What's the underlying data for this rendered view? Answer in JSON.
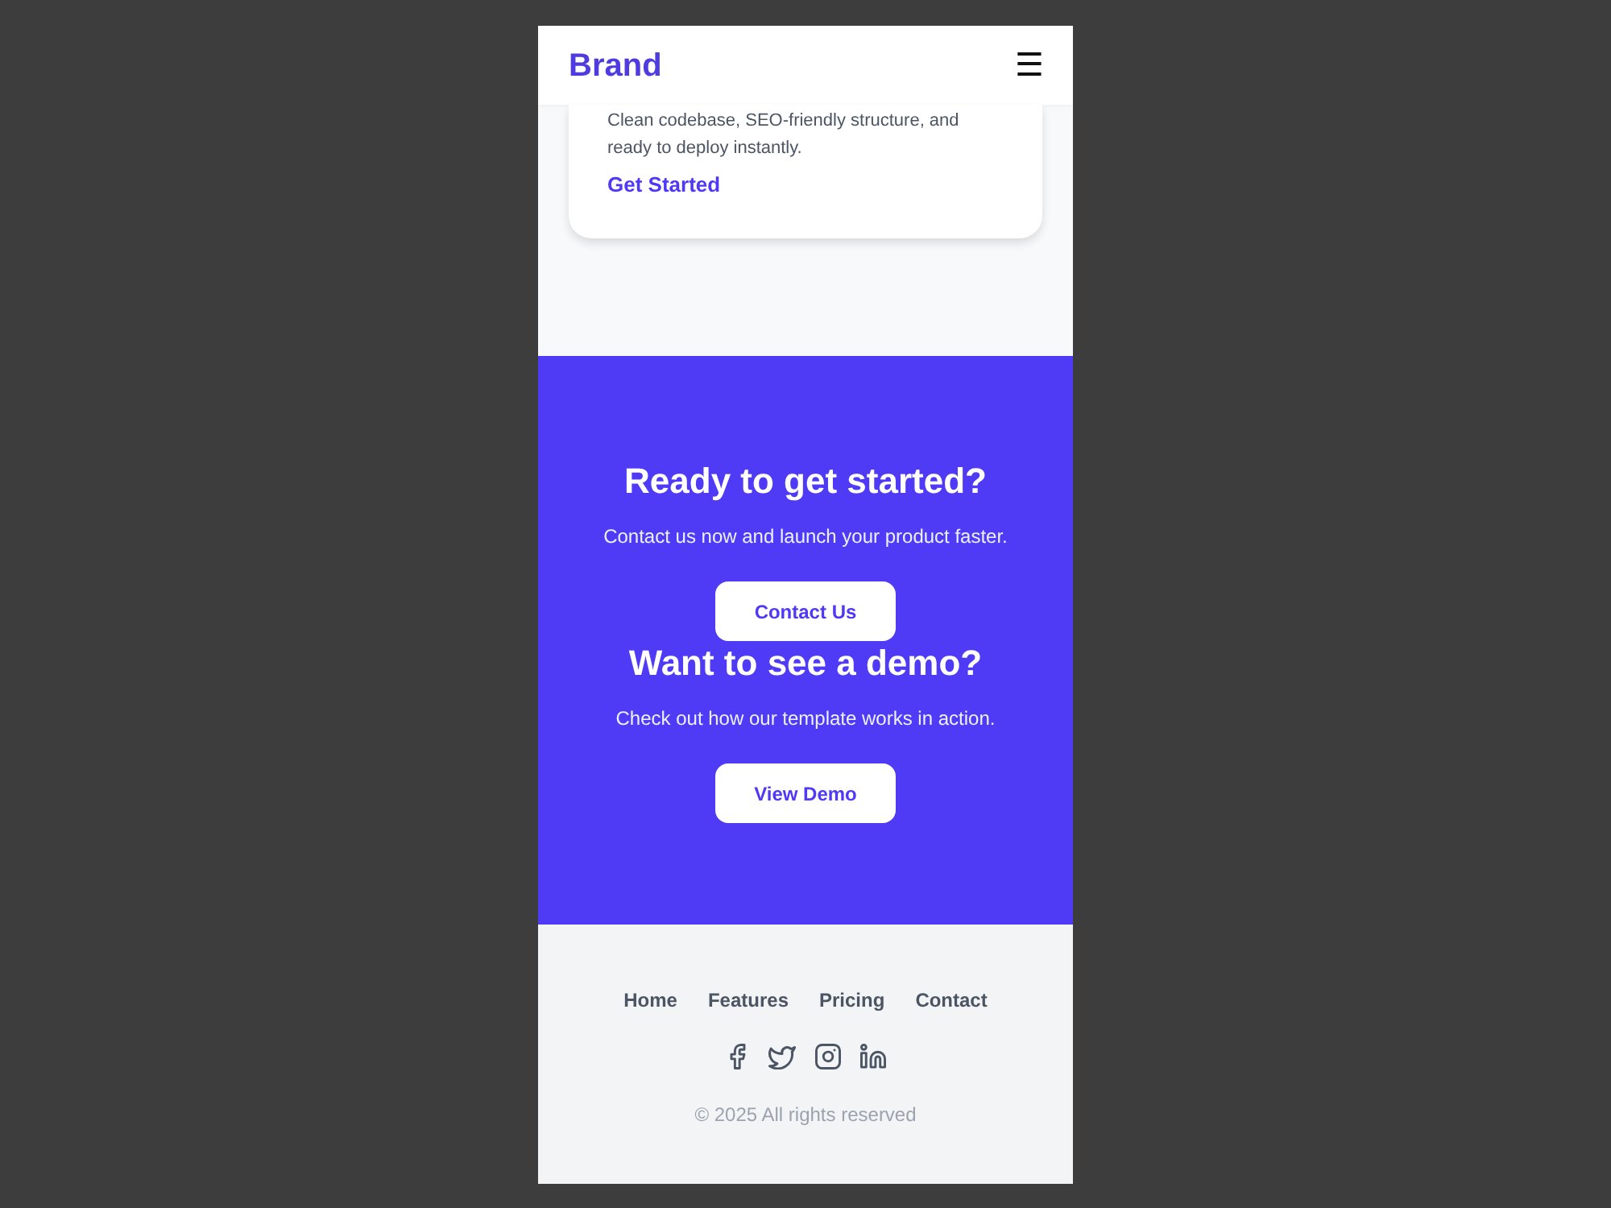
{
  "header": {
    "brand": "Brand",
    "menu_button": "☰"
  },
  "feature_card": {
    "description": "Clean codebase, SEO-friendly structure, and ready to deploy instantly.",
    "link": "Get Started"
  },
  "cta_sections": [
    {
      "title": "Ready to get started?",
      "text": "Contact us now and launch your product faster.",
      "button": "Contact Us"
    },
    {
      "title": "Want to see a demo?",
      "text": "Check out how our template works in action.",
      "button": "View Demo"
    }
  ],
  "footer": {
    "links": [
      "Home",
      "Features",
      "Pricing",
      "Contact"
    ],
    "copyright": "© 2025 All rights reserved"
  }
}
